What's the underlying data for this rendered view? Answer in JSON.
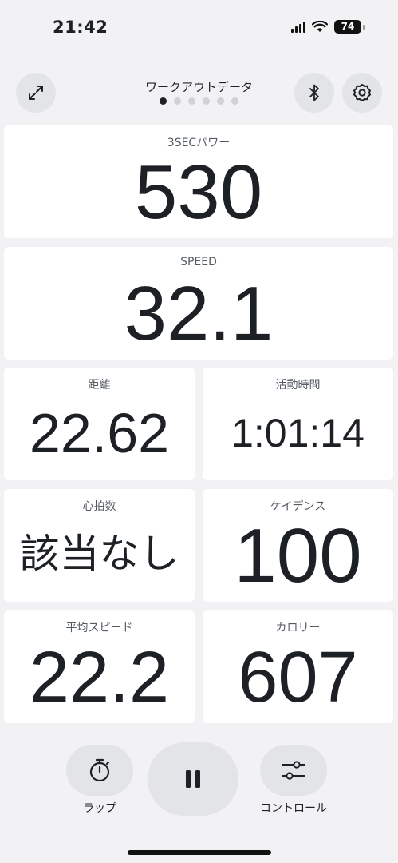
{
  "status_bar": {
    "time": "21:42",
    "battery": "74"
  },
  "header": {
    "title": "ワークアウトデータ",
    "page_count": 6,
    "active_page": 0
  },
  "cards": {
    "power": {
      "label": "3SECパワー",
      "value": "530"
    },
    "speed": {
      "label": "SPEED",
      "value": "32.1"
    },
    "distance": {
      "label": "距離",
      "value": "22.62"
    },
    "active_time": {
      "label": "活動時間",
      "value": "1:01:14"
    },
    "heart_rate": {
      "label": "心拍数",
      "value": "該当なし"
    },
    "cadence": {
      "label": "ケイデンス",
      "value": "100"
    },
    "avg_speed": {
      "label": "平均スピード",
      "value": "22.2"
    },
    "calories": {
      "label": "カロリー",
      "value": "607"
    }
  },
  "controls": {
    "lap_label": "ラップ",
    "control_label": "コントロール"
  },
  "icons": {
    "expand": "expand-icon",
    "bluetooth": "bluetooth-icon",
    "settings": "gear-icon",
    "lap": "stopwatch-icon",
    "pause": "pause-icon",
    "controls": "sliders-icon"
  }
}
